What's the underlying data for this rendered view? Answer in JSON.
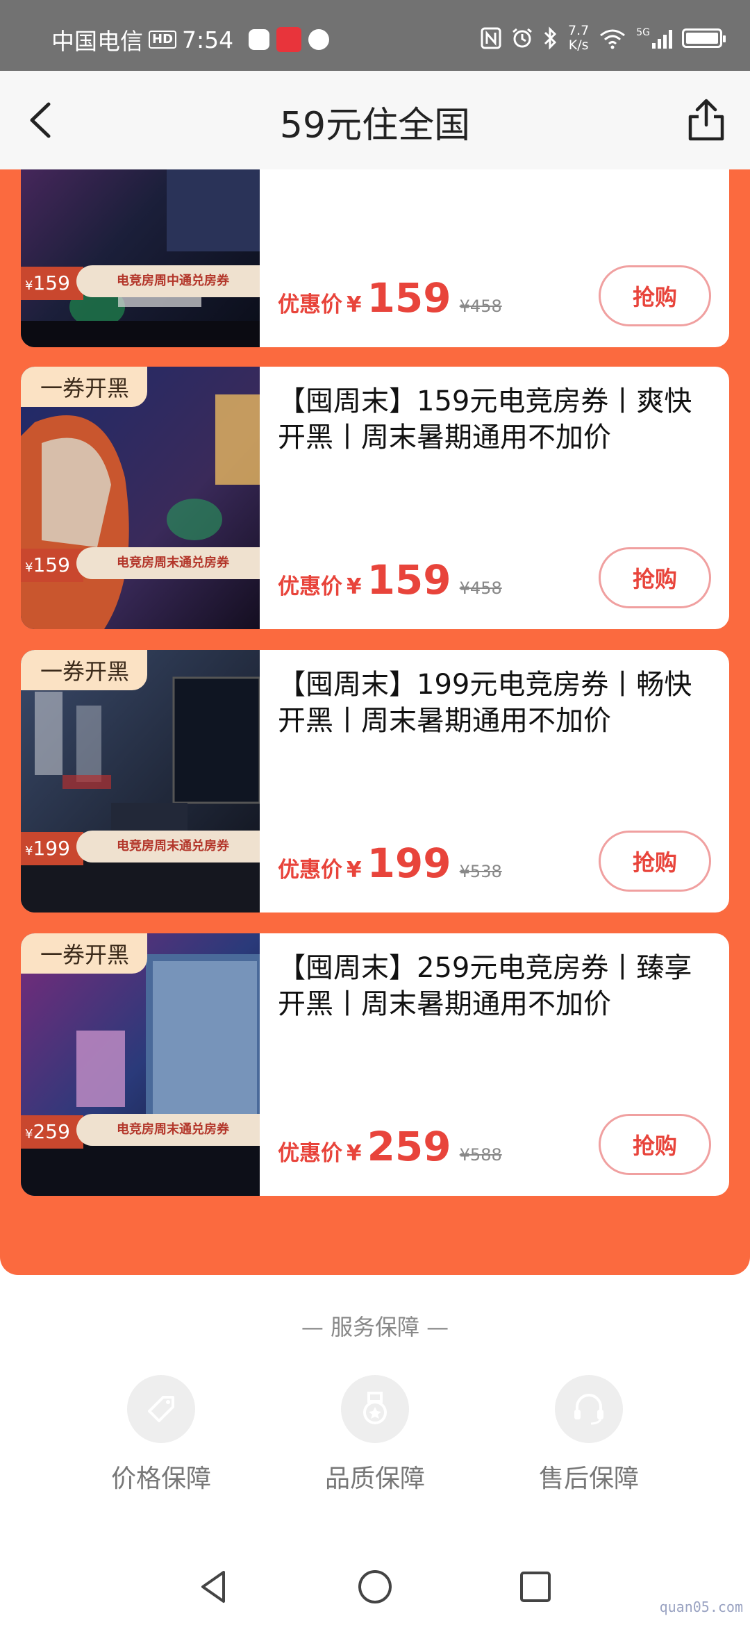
{
  "status_bar": {
    "carrier": "中国电信",
    "hd": "HD",
    "time": "7:54",
    "net_speed_value": "7.7",
    "net_speed_unit": "K/s",
    "network": "5G",
    "icons": [
      "nfc-icon",
      "alarm-icon",
      "bluetooth-icon",
      "wifi-icon",
      "signal-icon",
      "battery-icon"
    ]
  },
  "header": {
    "title": "59元住全国",
    "back_icon": "chevron-left-icon",
    "share_icon": "share-icon"
  },
  "cards": [
    {
      "tag": "",
      "title": "",
      "badge_price": "159",
      "ribbon": "电竞房周中通兑房券",
      "price_label": "优惠价",
      "currency": "¥",
      "price": "159",
      "original_price": "¥458",
      "button": "抢购"
    },
    {
      "tag": "一券开黑",
      "title": "【囤周末】159元电竞房券丨爽快开黑丨周末暑期通用不加价",
      "badge_price": "159",
      "ribbon": "电竞房周末通兑房券",
      "price_label": "优惠价",
      "currency": "¥",
      "price": "159",
      "original_price": "¥458",
      "button": "抢购"
    },
    {
      "tag": "一券开黑",
      "title": "【囤周末】199元电竞房券丨畅快开黑丨周末暑期通用不加价",
      "badge_price": "199",
      "ribbon": "电竞房周末通兑房券",
      "price_label": "优惠价",
      "currency": "¥",
      "price": "199",
      "original_price": "¥538",
      "button": "抢购"
    },
    {
      "tag": "一券开黑",
      "title": "【囤周末】259元电竞房券丨臻享开黑丨周末暑期通用不加价",
      "badge_price": "259",
      "ribbon": "电竞房周末通兑房券",
      "price_label": "优惠价",
      "currency": "¥",
      "price": "259",
      "original_price": "¥588",
      "button": "抢购"
    }
  ],
  "service": {
    "title": "— 服务保障 —",
    "items": [
      {
        "label": "价格保障",
        "icon": "price-tag-icon"
      },
      {
        "label": "品质保障",
        "icon": "quality-medal-icon"
      },
      {
        "label": "售后保障",
        "icon": "headset-icon"
      }
    ]
  },
  "nav": {
    "icons": [
      "back-triangle-icon",
      "home-circle-icon",
      "recents-square-icon"
    ]
  },
  "watermark": "quan05.com",
  "colors": {
    "panel": "#fb6a3f",
    "price": "#e8443b",
    "tag_bg": "#fbe2c4",
    "status_bar": "#727272"
  }
}
